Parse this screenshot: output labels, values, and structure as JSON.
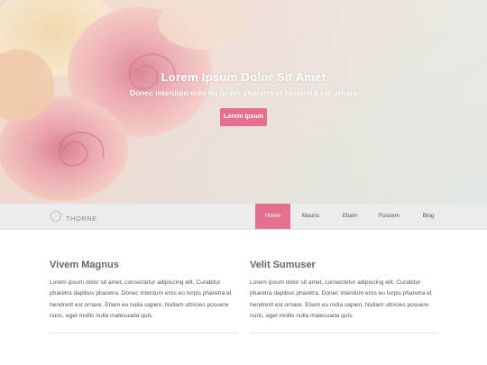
{
  "hero": {
    "title": "Lorem Ipsum Dolor Sit Amet",
    "subtitle": "Donec interdum eros eu turpis pharetra et hendrerit est ornare",
    "button_label": "Lorem Ipsum"
  },
  "brand": {
    "name": "THORNE",
    "logo_icon": "circle-dots-icon"
  },
  "nav": {
    "items": [
      {
        "label": "Home",
        "active": true
      },
      {
        "label": "Mauris",
        "active": false
      },
      {
        "label": "Etiam",
        "active": false
      },
      {
        "label": "Fuscem",
        "active": false
      },
      {
        "label": "Blog",
        "active": false
      }
    ]
  },
  "columns": [
    {
      "heading": "Vivem Magnus",
      "body": "Lorem ipsum dolor sit amet, consectetur adipiscing elit. Curabitur pharetra dapibus pharetra. Donec interdum eros eu turpis pharetra et hendrerit est ornare. Etiam eu nulla sapien. Nullam ultricies posuere nunc, eget mollis nulla malesuada quis."
    },
    {
      "heading": "Velit Sumuser",
      "body": "Lorem ipsum dolor sit amet, consectetur adipiscing elit. Curabitur pharetra dapibus pharetra. Donec interdum eros eu turpis pharetra et hendrerit est ornare. Etiam eu nulla sapien. Nullam ultricies posuere nunc, eget mollis nulla malesuada quis."
    }
  ],
  "colors": {
    "accent": "#e4708f",
    "nav_bg": "#ececec",
    "heading": "#666666"
  }
}
